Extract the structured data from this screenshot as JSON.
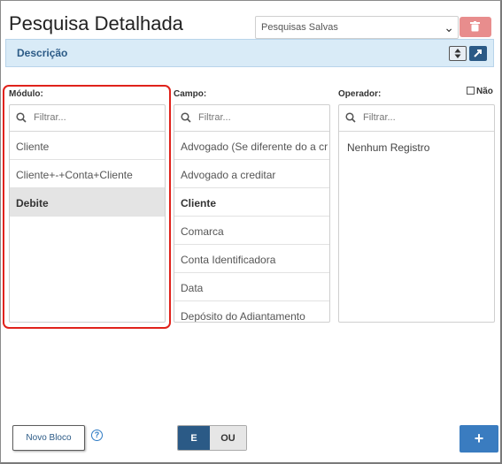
{
  "header": {
    "title": "Pesquisa Detalhada",
    "saved_searches": "Pesquisas Salvas",
    "delete_icon": "trash-icon"
  },
  "description_bar": {
    "label": "Descrição"
  },
  "modulo": {
    "label": "Módulo:",
    "filter_placeholder": "Filtrar...",
    "items": [
      "Cliente",
      "Cliente+-+Conta+Cliente",
      "Debite"
    ],
    "selected": "Debite"
  },
  "campo": {
    "label": "Campo:",
    "filter_placeholder": "Filtrar...",
    "items": [
      "Advogado (Se diferente do a cr",
      "Advogado a creditar",
      "Cliente",
      "Comarca",
      "Conta Identificadora",
      "Data",
      "Depósito do Adiantamento"
    ]
  },
  "operador": {
    "label": "Operador:",
    "not_label": "Não",
    "filter_placeholder": "Filtrar...",
    "empty_text": "Nenhum Registro"
  },
  "footer": {
    "new_block": "Novo Bloco",
    "help": "?",
    "and_label": "E",
    "or_label": "OU",
    "add": "+"
  },
  "colors": {
    "accent": "#2b5a86",
    "desc_bg": "#d9ebf7",
    "delete_bg": "#e88d8d",
    "highlight": "#e0221b",
    "add_bg": "#3a7cc0"
  }
}
